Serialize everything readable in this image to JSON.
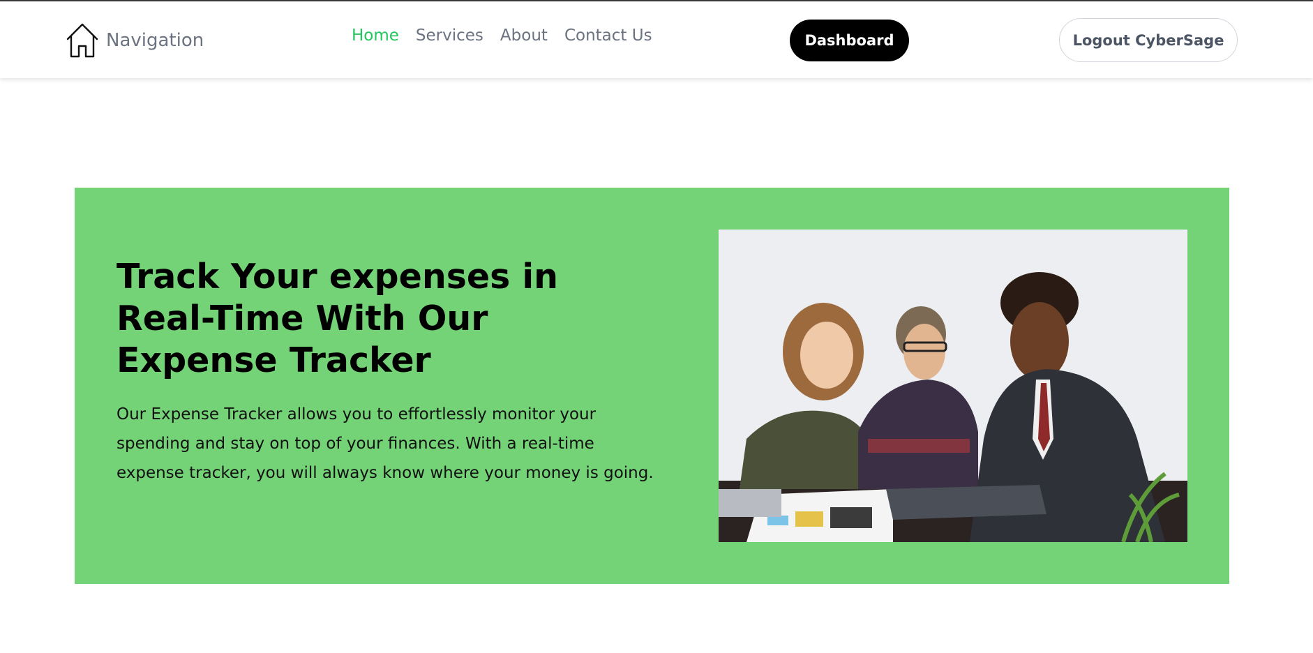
{
  "header": {
    "brand_icon": "home-icon",
    "brand_label": "Navigation",
    "nav": [
      {
        "label": "Home",
        "active": true
      },
      {
        "label": "Services",
        "active": false
      },
      {
        "label": "About",
        "active": false
      },
      {
        "label": "Contact Us",
        "active": false
      }
    ],
    "dashboard_label": "Dashboard",
    "logout_label": "Logout CyberSage"
  },
  "hero": {
    "title": "Track Your expenses in Real-Time With Our Expense Tracker",
    "description": "Our Expense Tracker allows you to effortlessly monitor your spending and stay on top of your finances. With a real-time expense tracker, you will always know where your money is going."
  },
  "colors": {
    "accent_green": "#22c55e",
    "hero_background": "#74d377",
    "nav_text": "#6b7280",
    "dashboard_button": "#000000"
  }
}
